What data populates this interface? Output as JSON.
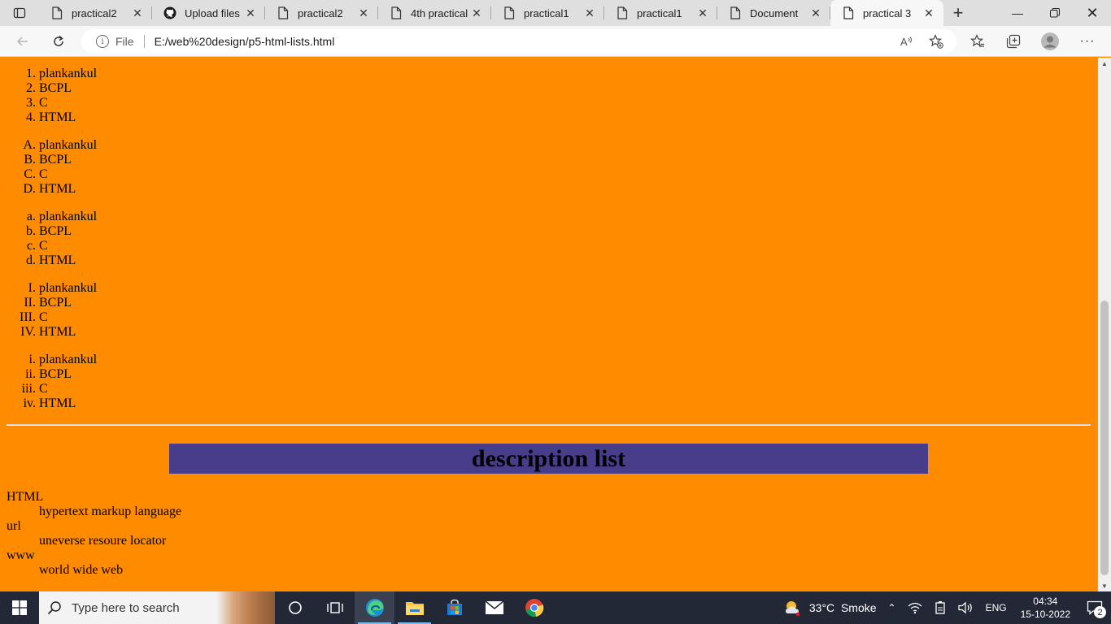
{
  "browser": {
    "tabs": [
      {
        "title": "practical2",
        "icon": "page-icon",
        "active": false
      },
      {
        "title": "Upload files ·",
        "icon": "github-icon",
        "active": false
      },
      {
        "title": "practical2",
        "icon": "page-icon",
        "active": false
      },
      {
        "title": "4th practical",
        "icon": "page-icon",
        "active": false
      },
      {
        "title": "practical1",
        "icon": "page-icon",
        "active": false
      },
      {
        "title": "practical1",
        "icon": "page-icon",
        "active": false
      },
      {
        "title": "Document",
        "icon": "page-icon",
        "active": false
      },
      {
        "title": "practical 3",
        "icon": "page-icon",
        "active": true
      }
    ],
    "address": {
      "scheme_label": "File",
      "url": "E:/web%20design/p5-html-lists.html"
    }
  },
  "page": {
    "lists": [
      {
        "type": "decimal",
        "markers": [
          "1.",
          "2.",
          "3.",
          "4."
        ],
        "items": [
          "plankankul",
          "BCPL",
          "C",
          "HTML"
        ]
      },
      {
        "type": "upper-alpha",
        "markers": [
          "A.",
          "B.",
          "C.",
          "D."
        ],
        "items": [
          "plankankul",
          "BCPL",
          "C",
          "HTML"
        ]
      },
      {
        "type": "lower-alpha",
        "markers": [
          "a.",
          "b.",
          "c.",
          "d."
        ],
        "items": [
          "plankankul",
          "BCPL",
          "C",
          "HTML"
        ]
      },
      {
        "type": "upper-roman",
        "markers": [
          "I.",
          "II.",
          "III.",
          "IV."
        ],
        "items": [
          "plankankul",
          "BCPL",
          "C",
          "HTML"
        ]
      },
      {
        "type": "lower-roman",
        "markers": [
          "i.",
          "ii.",
          "iii.",
          "iv."
        ],
        "items": [
          "plankankul",
          "BCPL",
          "C",
          "HTML"
        ]
      }
    ],
    "heading": "description list",
    "description_list": [
      {
        "term": "HTML",
        "desc": "hypertext markup language"
      },
      {
        "term": "url",
        "desc": "uneverse resoure locator"
      },
      {
        "term": "www",
        "desc": "world wide web"
      }
    ],
    "colors": {
      "background": "#ff8c00",
      "banner": "#483d8b"
    }
  },
  "taskbar": {
    "search_placeholder": "Type here to search",
    "weather": "33°C  Smoke",
    "language": "ENG",
    "time": "04:34",
    "date": "15-10-2022",
    "notification_count": "2"
  }
}
